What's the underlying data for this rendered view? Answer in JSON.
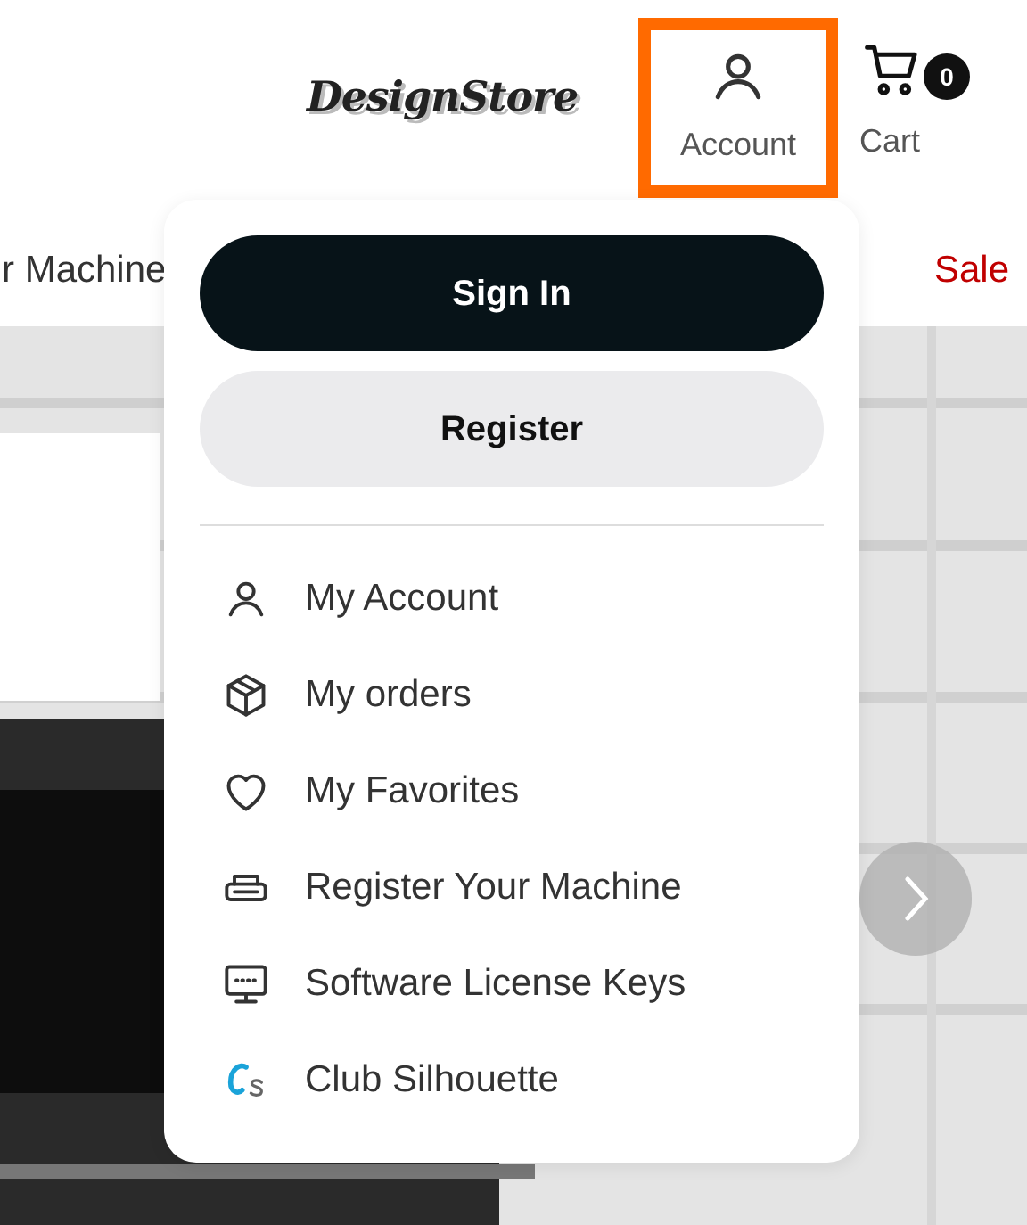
{
  "header": {
    "logo": "DesignStore",
    "account": {
      "label": "Account",
      "highlighted": true
    },
    "cart": {
      "label": "Cart",
      "count": "0"
    }
  },
  "nav": {
    "items": [
      "r Machine",
      "Sale"
    ]
  },
  "account_menu": {
    "sign_in": "Sign In",
    "register": "Register",
    "items": [
      {
        "label": "My Account"
      },
      {
        "label": "My orders"
      },
      {
        "label": "My Favorites"
      },
      {
        "label": "Register Your Machine"
      },
      {
        "label": "Software License Keys"
      },
      {
        "label": "Club Silhouette"
      }
    ]
  }
}
